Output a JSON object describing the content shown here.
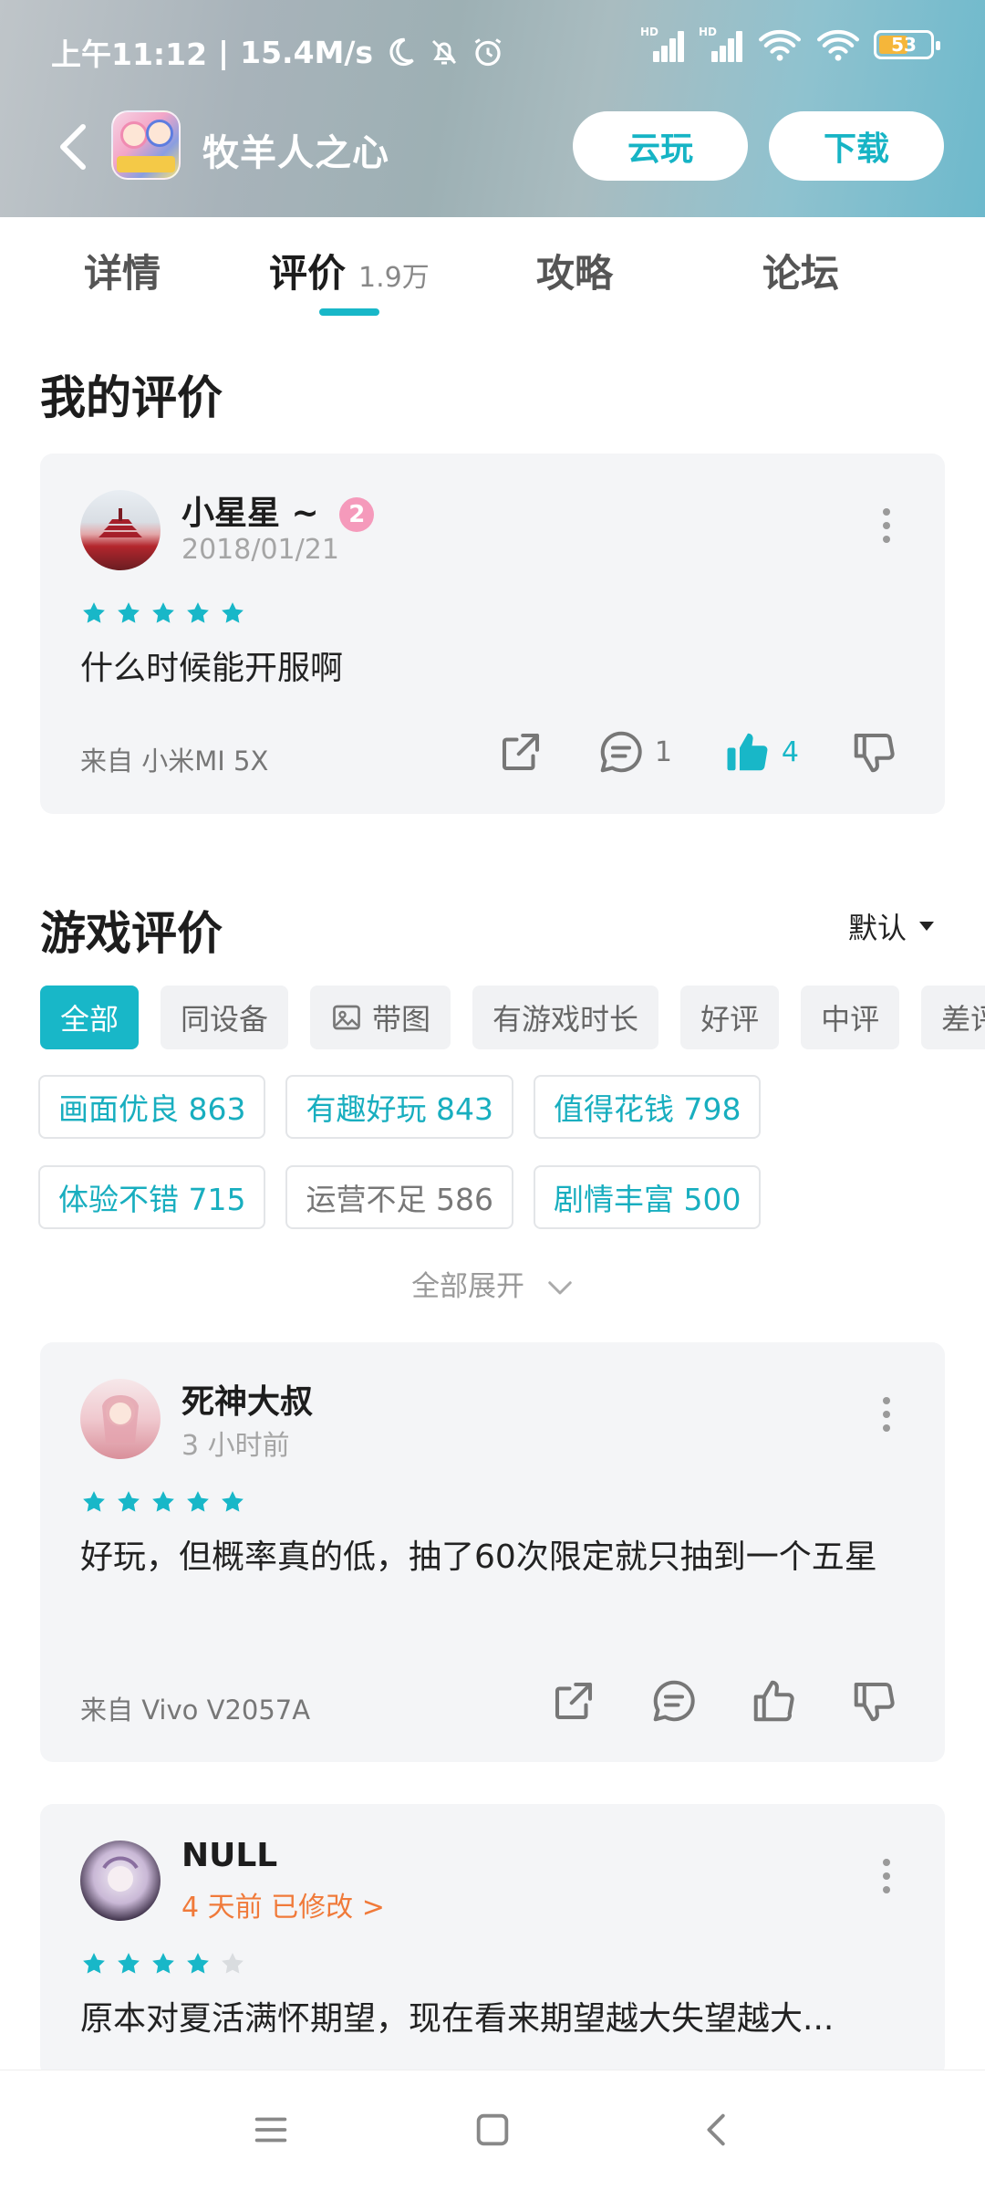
{
  "status": {
    "time": "上午11:12",
    "speed": "15.4M/s",
    "battery": "53",
    "hd": "HD"
  },
  "header": {
    "title": "牧羊人之心",
    "cloud_play": "云玩",
    "download": "下载"
  },
  "tabs": [
    {
      "label": "详情",
      "count": ""
    },
    {
      "label": "评价",
      "count": "1.9万"
    },
    {
      "label": "攻略",
      "count": ""
    },
    {
      "label": "论坛",
      "count": ""
    }
  ],
  "my_review": {
    "section_title": "我的评价",
    "user": "小星星 ~",
    "level_badge": "2",
    "date": "2018/01/21",
    "rating": 5,
    "content": "什么时候能开服啊",
    "device": "来自 小米MI 5X",
    "comments": "1",
    "likes": "4"
  },
  "game_reviews": {
    "section_title": "游戏评价",
    "sort_label": "默认",
    "filters": [
      "全部",
      "同设备",
      "带图",
      "有游戏时长",
      "好评",
      "中评",
      "差评"
    ],
    "tags_row1": [
      {
        "label": "画面优良 863"
      },
      {
        "label": "有趣好玩 843"
      },
      {
        "label": "值得花钱 798"
      }
    ],
    "tags_row2": [
      {
        "label": "体验不错 715"
      },
      {
        "label": "运营不足 586"
      },
      {
        "label": "剧情丰富 500"
      }
    ],
    "expand_label": "全部展开"
  },
  "reviews": [
    {
      "user": "死神大叔",
      "time": "3 小时前",
      "rating": 5,
      "content": "好玩，但概率真的低，抽了60次限定就只抽到一个五星",
      "device": "来自 Vivo V2057A"
    },
    {
      "user": "NULL",
      "time": "4 天前 已修改 >",
      "rating": 4,
      "content": "原本对夏活满怀期望，现在看来期望越大失望越大..."
    }
  ],
  "colors": {
    "accent": "#18b7c8",
    "edited": "#f07a3a"
  }
}
